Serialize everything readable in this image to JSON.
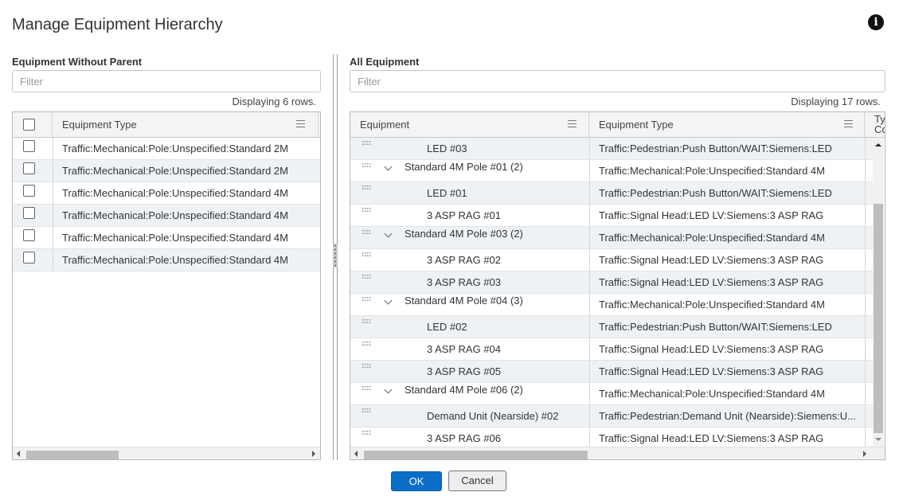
{
  "dialog": {
    "title": "Manage Equipment Hierarchy",
    "info_icon": "info-circle-icon"
  },
  "left_panel": {
    "label": "Equipment Without Parent",
    "filter_placeholder": "Filter",
    "row_count_text": "Displaying 6 rows.",
    "column_header": "Equipment Type",
    "rows": [
      "Traffic:Mechanical:Pole:Unspecified:Standard 2M",
      "Traffic:Mechanical:Pole:Unspecified:Standard 2M",
      "Traffic:Mechanical:Pole:Unspecified:Standard 4M",
      "Traffic:Mechanical:Pole:Unspecified:Standard 4M",
      "Traffic:Mechanical:Pole:Unspecified:Standard 4M",
      "Traffic:Mechanical:Pole:Unspecified:Standard 4M"
    ]
  },
  "right_panel": {
    "label": "All Equipment",
    "filter_placeholder": "Filter",
    "row_count_text": "Displaying 17 rows.",
    "column_headers": [
      "Equipment",
      "Equipment Type",
      "Ty",
      "Cc"
    ],
    "rows": [
      {
        "equipment": "LED #03",
        "type": "Traffic:Pedestrian:Push Button/WAIT:Siemens:LED",
        "parent": false
      },
      {
        "equipment": "Standard 4M Pole #01  (2)",
        "type": "Traffic:Mechanical:Pole:Unspecified:Standard 4M",
        "parent": true
      },
      {
        "equipment": "LED #01",
        "type": "Traffic:Pedestrian:Push Button/WAIT:Siemens:LED",
        "parent": false
      },
      {
        "equipment": "3 ASP RAG #01",
        "type": "Traffic:Signal Head:LED LV:Siemens:3 ASP RAG",
        "parent": false
      },
      {
        "equipment": "Standard 4M Pole #03  (2)",
        "type": "Traffic:Mechanical:Pole:Unspecified:Standard 4M",
        "parent": true
      },
      {
        "equipment": "3 ASP RAG #02",
        "type": "Traffic:Signal Head:LED LV:Siemens:3 ASP RAG",
        "parent": false
      },
      {
        "equipment": "3 ASP RAG #03",
        "type": "Traffic:Signal Head:LED LV:Siemens:3 ASP RAG",
        "parent": false
      },
      {
        "equipment": "Standard 4M Pole #04  (3)",
        "type": "Traffic:Mechanical:Pole:Unspecified:Standard 4M",
        "parent": true
      },
      {
        "equipment": "LED #02",
        "type": "Traffic:Pedestrian:Push Button/WAIT:Siemens:LED",
        "parent": false
      },
      {
        "equipment": "3 ASP RAG #04",
        "type": "Traffic:Signal Head:LED LV:Siemens:3 ASP RAG",
        "parent": false
      },
      {
        "equipment": "3 ASP RAG #05",
        "type": "Traffic:Signal Head:LED LV:Siemens:3 ASP RAG",
        "parent": false
      },
      {
        "equipment": "Standard 4M Pole #06  (2)",
        "type": "Traffic:Mechanical:Pole:Unspecified:Standard 4M",
        "parent": true
      },
      {
        "equipment": "Demand Unit (Nearside) #02",
        "type": "Traffic:Pedestrian:Demand Unit (Nearside):Siemens:U...",
        "parent": false
      },
      {
        "equipment": "3 ASP RAG #06",
        "type": "Traffic:Signal Head:LED LV:Siemens:3 ASP RAG",
        "parent": false
      }
    ]
  },
  "buttons": {
    "ok_label": "OK",
    "cancel_label": "Cancel"
  },
  "colors": {
    "primary_button": "#0a6ec7",
    "row_alt": "#eff2f5"
  }
}
